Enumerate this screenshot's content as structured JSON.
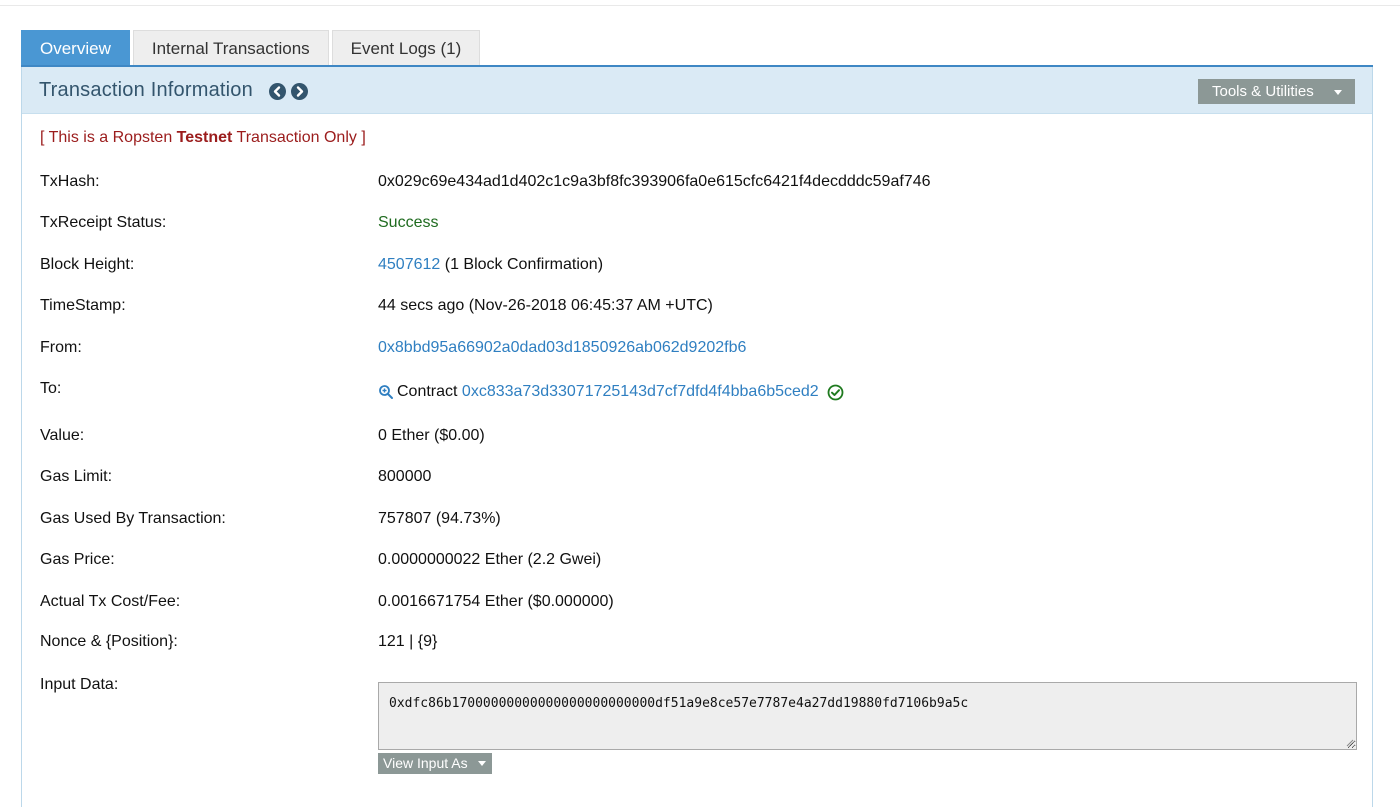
{
  "tabs": [
    {
      "label": "Overview",
      "active": true
    },
    {
      "label": "Internal Transactions",
      "active": false
    },
    {
      "label": "Event Logs (1)",
      "active": false
    }
  ],
  "panel": {
    "title": "Transaction Information",
    "prev_icon": "chevron-left-circle-icon",
    "next_icon": "chevron-right-circle-icon",
    "tools_label": "Tools & Utilities"
  },
  "notice": {
    "prefix": "[ This is a Ropsten ",
    "bold": "Testnet",
    "suffix": " Transaction Only ]"
  },
  "fields": {
    "txhash": {
      "label": "TxHash:",
      "value": "0x029c69e434ad1d402c1c9a3bf8fc393906fa0e615cfc6421f4decdddc59af746"
    },
    "status": {
      "label": "TxReceipt Status:",
      "value": "Success"
    },
    "block": {
      "label": "Block Height:",
      "link": "4507612",
      "suffix": " (1 Block Confirmation)"
    },
    "timestamp": {
      "label": "TimeStamp:",
      "value": "44 secs ago (Nov-26-2018 06:45:37 AM +UTC)"
    },
    "from": {
      "label": "From:",
      "value": "0x8bbd95a66902a0dad03d1850926ab062d9202fb6"
    },
    "to": {
      "label": "To:",
      "prefix": "Contract ",
      "link": "0xc833a73d33071725143d7cf7dfd4f4bba6b5ced2"
    },
    "value": {
      "label": "Value:",
      "value": "0 Ether ($0.00)"
    },
    "gas_limit": {
      "label": "Gas Limit:",
      "value": "800000"
    },
    "gas_used": {
      "label": "Gas Used By Transaction:",
      "value": "757807 (94.73%)"
    },
    "gas_price": {
      "label": "Gas Price:",
      "value": "0.0000000022 Ether (2.2 Gwei)"
    },
    "fee": {
      "label": "Actual Tx Cost/Fee:",
      "value": "0.0016671754 Ether ($0.000000)"
    },
    "nonce": {
      "label": "Nonce & {Position}:",
      "value": "121 | {9}"
    },
    "input": {
      "label": "Input Data:",
      "value": "0xdfc86b17000000000000000000000000df51a9e8ce57e7787e4a27dd19880fd7106b9a5c"
    }
  },
  "view_input_label": "View Input As",
  "colors": {
    "tab_active": "#4a97d3",
    "header_bg": "#daeaf5",
    "link": "#2f7fc1",
    "notice": "#9b1c1c",
    "success": "#1f6b1f",
    "button_gray": "#8c9896"
  }
}
